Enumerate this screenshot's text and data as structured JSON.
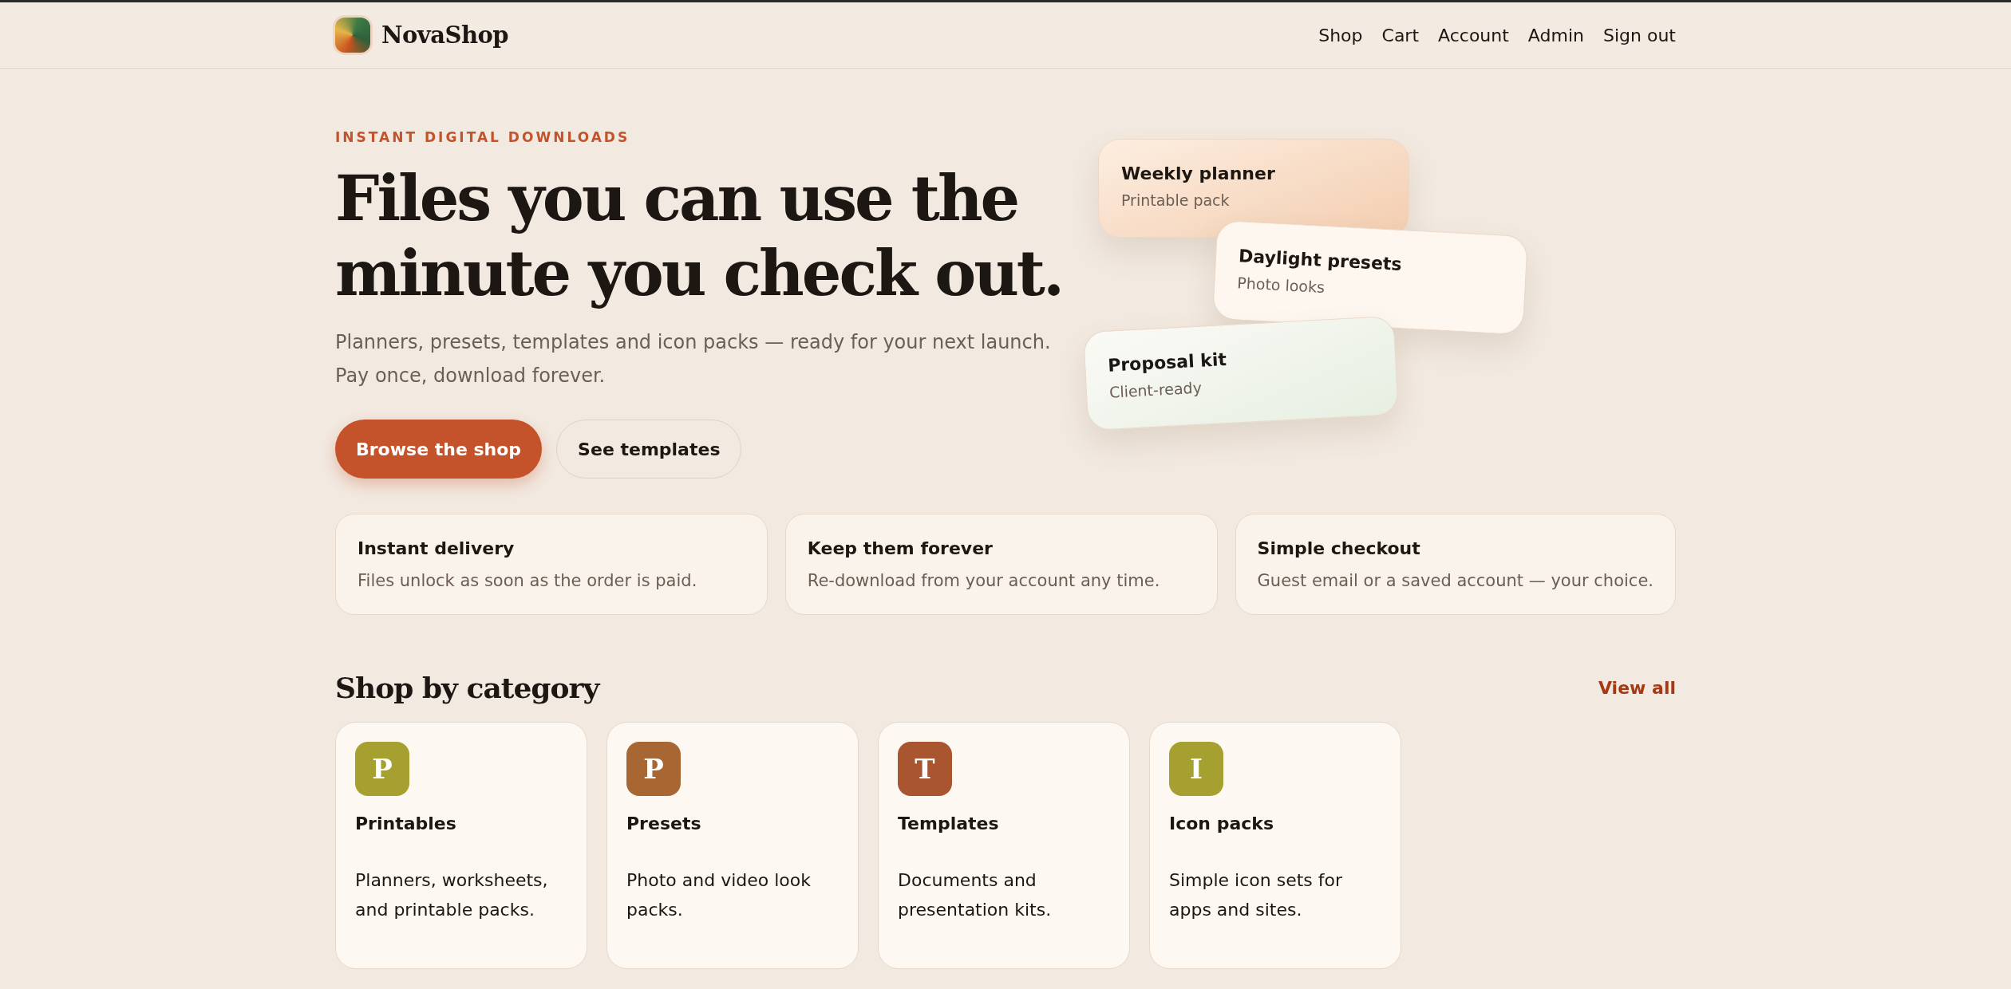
{
  "header": {
    "brand": "NovaShop",
    "nav": [
      "Shop",
      "Cart",
      "Account",
      "Admin",
      "Sign out"
    ]
  },
  "hero": {
    "eyebrow": "INSTANT DIGITAL DOWNLOADS",
    "title_lines": [
      "Files you can use the",
      "minute you check out."
    ],
    "subtitle_lines": [
      "Planners, presets, templates and icon packs — ready for your next launch.",
      "Pay once, download forever."
    ],
    "buttons": [
      {
        "label": "Browse the shop",
        "kind": "primary"
      },
      {
        "label": "See templates",
        "kind": "secondary"
      }
    ],
    "preview_cards": [
      {
        "title": "Weekly planner",
        "subtitle": "Printable pack",
        "kind": "peach"
      },
      {
        "title": "Daylight presets",
        "subtitle": "Photo looks",
        "kind": "cream"
      },
      {
        "title": "Proposal kit",
        "subtitle": "Client-ready",
        "kind": "mint"
      }
    ]
  },
  "features": [
    {
      "title": "Instant delivery",
      "text": "Files unlock as soon as the order is paid."
    },
    {
      "title": "Keep them forever",
      "text": "Re-download from your account any time."
    },
    {
      "title": "Simple checkout",
      "text": "Guest email or a saved account — your choice."
    }
  ],
  "categories": {
    "heading": "Shop by category",
    "link": "View all",
    "items": [
      {
        "letter": "P",
        "name": "Printables",
        "description": "Planners, worksheets, and printable packs.",
        "color": "#a6a030"
      },
      {
        "letter": "P",
        "name": "Presets",
        "description": "Photo and video look packs.",
        "color": "#a86632"
      },
      {
        "letter": "T",
        "name": "Templates",
        "description": "Documents and presentation kits.",
        "color": "#a85530"
      },
      {
        "letter": "I",
        "name": "Icon packs",
        "description": "Simple icon sets for apps and sites.",
        "color": "#a6a030"
      }
    ]
  }
}
